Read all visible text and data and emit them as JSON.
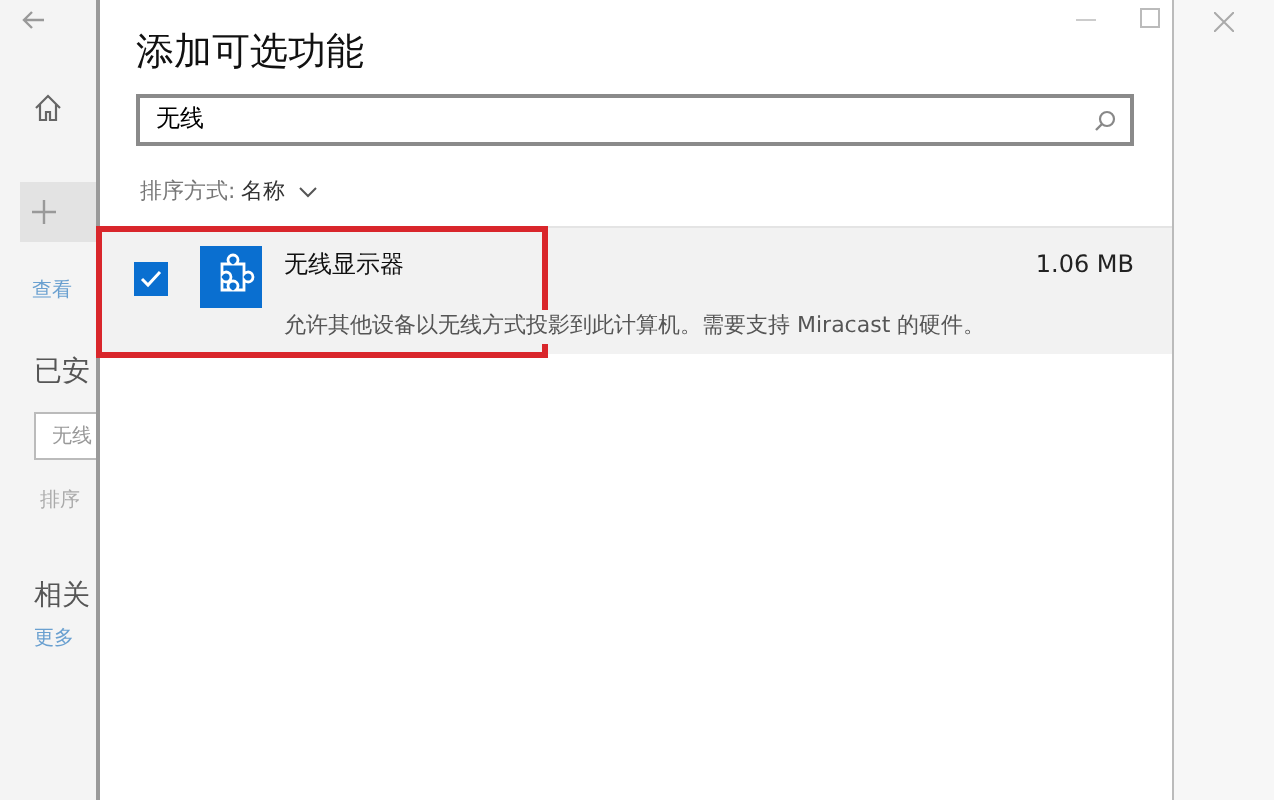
{
  "background_window": {
    "link_text": "查看",
    "section_title": "已安",
    "search_value": "无线",
    "sort_text": "排序",
    "related_title": "相关",
    "related_link": "更多"
  },
  "dialog": {
    "title": "添加可选功能",
    "search": {
      "value": "无线"
    },
    "sort": {
      "label": "排序方式:",
      "value": "名称"
    },
    "features": [
      {
        "name": "无线显示器",
        "size": "1.06 MB",
        "description": "允许其他设备以无线方式投影到此计算机。需要支持 Miracast 的硬件。",
        "checked": true,
        "highlighted": true
      }
    ]
  }
}
